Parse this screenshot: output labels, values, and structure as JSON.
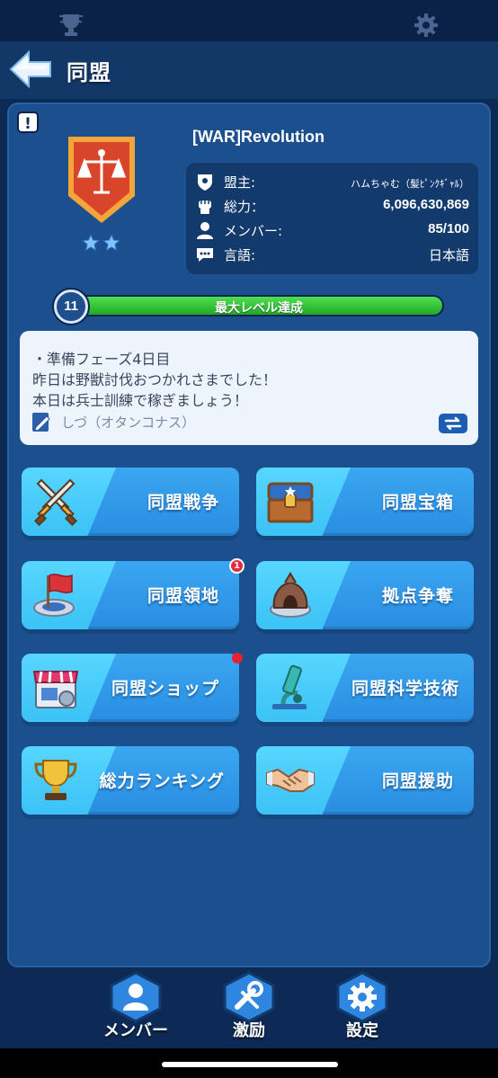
{
  "top_bar": {
    "trophy_icon": "trophy-icon",
    "settings_icon": "gear-icon"
  },
  "header": {
    "title": "同盟",
    "back_icon": "back-arrow-icon"
  },
  "alliance": {
    "name": "[WAR]Revolution",
    "stars": 2,
    "info": [
      {
        "icon": "leader-shield-icon",
        "label": "盟主:",
        "value": "ハムちゃむ（髪ﾋﾟﾝｸｷﾞｬﾙ）"
      },
      {
        "icon": "fist-icon",
        "label": "総力：",
        "value": "6,096,630,869"
      },
      {
        "icon": "person-icon",
        "label": "メンバー:",
        "value": "85/100"
      },
      {
        "icon": "chat-icon",
        "label": "言語:",
        "value": "日本語"
      }
    ]
  },
  "level": {
    "value": "11",
    "label": "最大レベル達成",
    "progress": 1.0
  },
  "notice": {
    "lines": [
      "・準備フェーズ4日目",
      "昨日は野獣討伐おつかれさまでした！",
      "本日は兵士訓練で稼ぎましょう！"
    ],
    "author": "しづ（オタンコナス）"
  },
  "menu": [
    {
      "label": "同盟戦争",
      "icon": "crossed-swords-icon"
    },
    {
      "label": "同盟宝箱",
      "icon": "treasure-chest-icon"
    },
    {
      "label": "同盟領地",
      "icon": "territory-flag-icon",
      "badge": "1"
    },
    {
      "label": "拠点争奪",
      "icon": "stronghold-icon"
    },
    {
      "label": "同盟ショップ",
      "icon": "shop-icon",
      "dot": true
    },
    {
      "label": "同盟科学技術",
      "icon": "microscope-icon"
    },
    {
      "label": "総力ランキング",
      "icon": "trophy-cup-icon"
    },
    {
      "label": "同盟援助",
      "icon": "handshake-icon"
    }
  ],
  "bottom_nav": [
    {
      "label": "メンバー",
      "icon": "members-icon"
    },
    {
      "label": "激励",
      "icon": "tools-icon"
    },
    {
      "label": "設定",
      "icon": "settings-gear-icon"
    }
  ],
  "colors": {
    "accent": "#3aa7f2",
    "panel": "#1c4f8e",
    "badge": "#e32b3b",
    "progress": "#2fc23a"
  }
}
